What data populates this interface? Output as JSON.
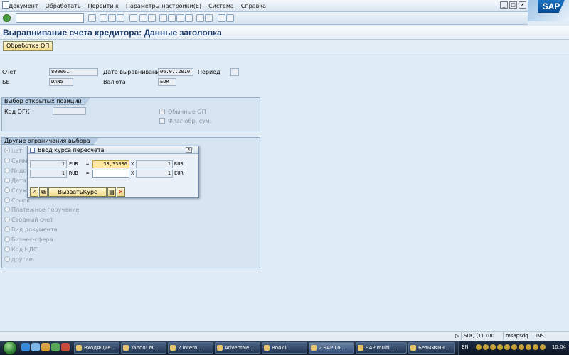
{
  "menu": [
    "Документ",
    "Обработать",
    "Перейти к",
    "Параметры настройки(E)",
    "Система",
    "Справка"
  ],
  "sap_logo": "SAP",
  "title": "Выравнивание счета кредитора: Данные заголовка",
  "app_toolbar": {
    "process_op_button": "Обработка ОП"
  },
  "header": {
    "account_label": "Счет",
    "account_value": "800061",
    "clearing_date_label": "Дата выравнивания",
    "clearing_date_value": "06.07.2010",
    "period_label": "Период",
    "period_value": "",
    "company_code_label": "БЕ",
    "company_code_value": "DAN5",
    "currency_label": "Валюта",
    "currency_value": "EUR"
  },
  "open_items_group": {
    "title": "Выбор открытых позиций",
    "special_gl_label": "Код ОГК",
    "special_gl_value": "",
    "normal_op_label": "Обычные ОП",
    "flag_label": "Флаг обр. сум."
  },
  "other_selection_group": {
    "title": "Другие ограничения выбора",
    "options": [
      "нет",
      "Сумма",
      "№ док",
      "Дата п",
      "Служб",
      "Ссылк",
      "Платежное поручение",
      "Сводный счет",
      "Вид документа",
      "Бизнес-сфера",
      "Код НДС",
      "другие"
    ]
  },
  "dialog": {
    "title": "Ввод курса пересчета",
    "row1": {
      "from_amount": "1",
      "from_currency": "EUR",
      "eq": "=",
      "rate": "38,33030",
      "mult": "X",
      "to_amount": "1",
      "to_currency": "RUB"
    },
    "row2": {
      "from_amount": "1",
      "from_currency": "RUB",
      "eq": "=",
      "rate": "",
      "mult": "X",
      "to_amount": "1",
      "to_currency": "EUR"
    },
    "call_rate_button": "ВызватьКурс"
  },
  "statusbar": {
    "system": "SDQ (1) 100",
    "server": "msapsdq",
    "mode": "INS"
  },
  "taskbar": {
    "tasks": [
      "Входящие...",
      "Yahoo! M...",
      "2 Intern...",
      "AdventNe...",
      "Book1",
      "2 SAP Lo...",
      "SAP multi ...",
      "Безымянн..."
    ],
    "lang": "EN",
    "clock": "10:04"
  },
  "colors": {
    "title": "#1d3b6b",
    "accent_button": "#f2dc8e",
    "background": "#dfebf5"
  }
}
